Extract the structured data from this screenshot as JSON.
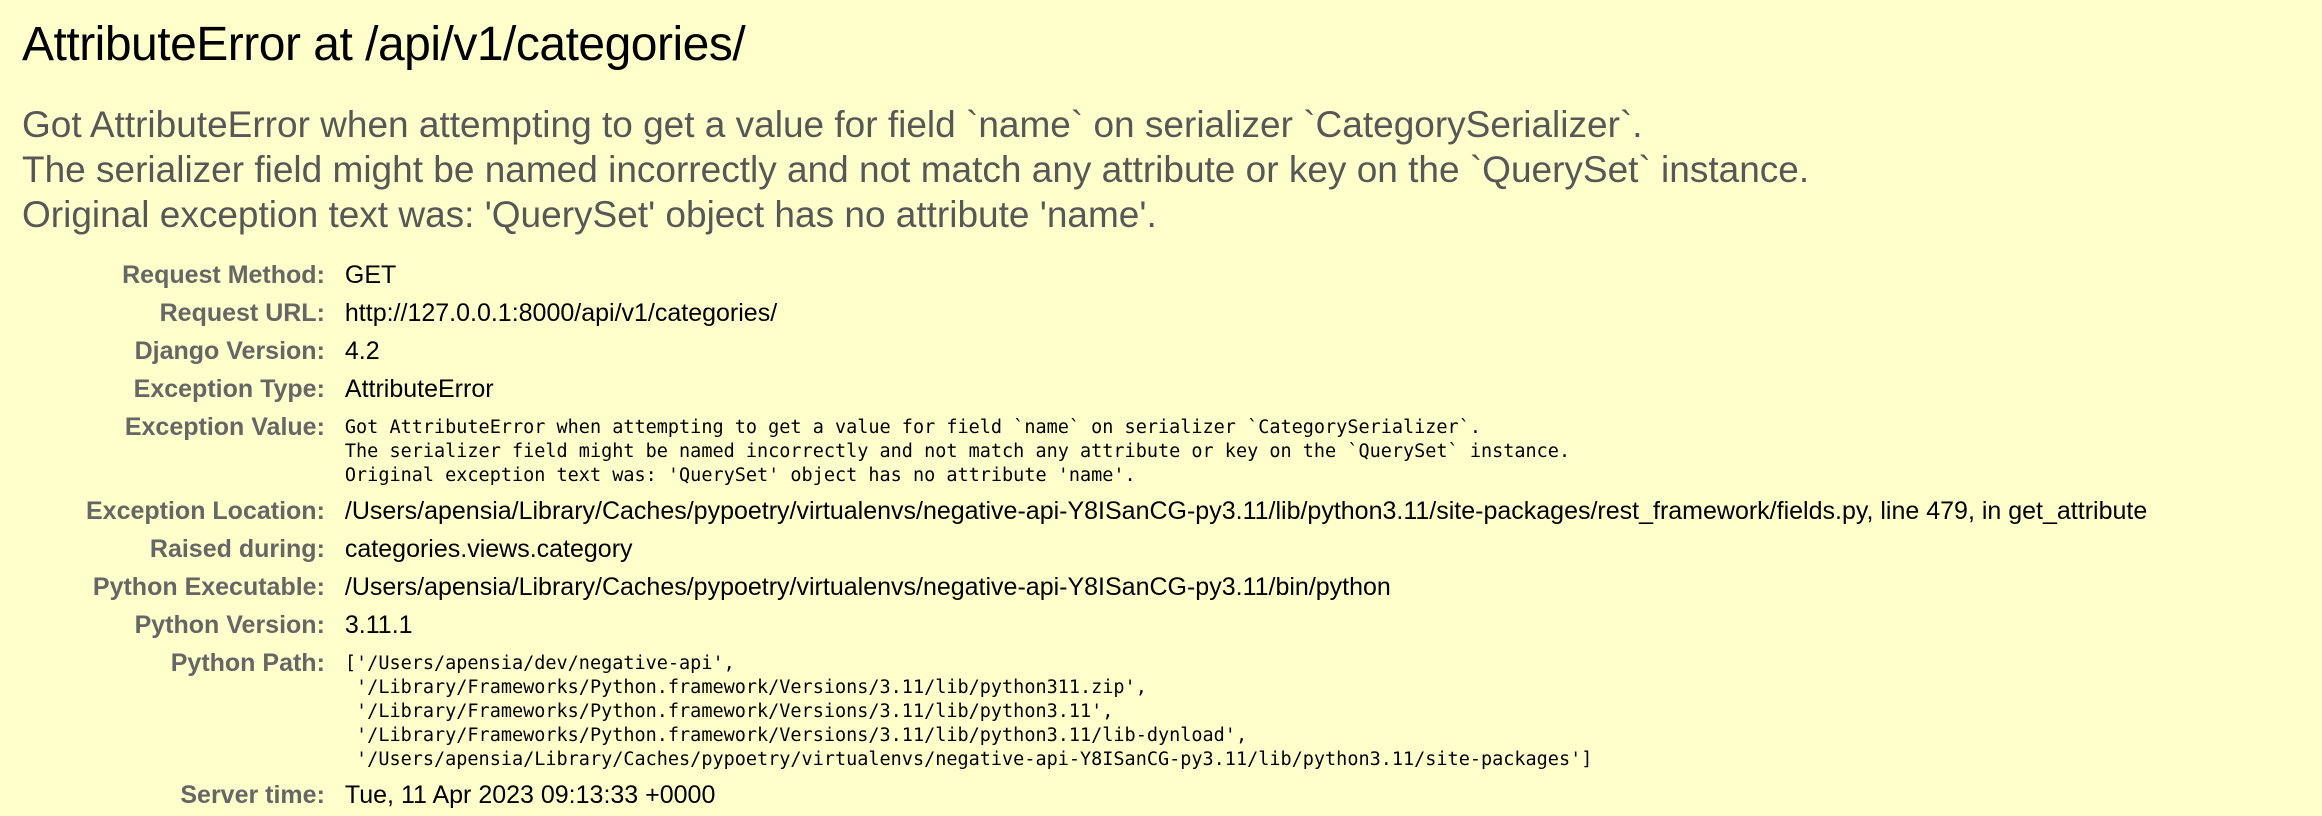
{
  "page": {
    "title": "AttributeError at /api/v1/categories/",
    "exception_value": "Got AttributeError when attempting to get a value for field `name` on serializer `CategorySerializer`.\nThe serializer field might be named incorrectly and not match any attribute or key on the `QuerySet` instance.\nOriginal exception text was: 'QuerySet' object has no attribute 'name'."
  },
  "meta": {
    "request_method": {
      "label": "Request Method:",
      "value": "GET"
    },
    "request_url": {
      "label": "Request URL:",
      "value": "http://127.0.0.1:8000/api/v1/categories/"
    },
    "django_version": {
      "label": "Django Version:",
      "value": "4.2"
    },
    "exception_type": {
      "label": "Exception Type:",
      "value": "AttributeError"
    },
    "exception_value": {
      "label": "Exception Value:",
      "value": "Got AttributeError when attempting to get a value for field `name` on serializer `CategorySerializer`.\nThe serializer field might be named incorrectly and not match any attribute or key on the `QuerySet` instance.\nOriginal exception text was: 'QuerySet' object has no attribute 'name'."
    },
    "exception_location": {
      "label": "Exception Location:",
      "value": "/Users/apensia/Library/Caches/pypoetry/virtualenvs/negative-api-Y8ISanCG-py3.11/lib/python3.11/site-packages/rest_framework/fields.py, line 479, in get_attribute"
    },
    "raised_during": {
      "label": "Raised during:",
      "value": "categories.views.category"
    },
    "python_executable": {
      "label": "Python Executable:",
      "value": "/Users/apensia/Library/Caches/pypoetry/virtualenvs/negative-api-Y8ISanCG-py3.11/bin/python"
    },
    "python_version": {
      "label": "Python Version:",
      "value": "3.11.1"
    },
    "python_path": {
      "label": "Python Path:",
      "value": "['/Users/apensia/dev/negative-api',\n '/Library/Frameworks/Python.framework/Versions/3.11/lib/python311.zip',\n '/Library/Frameworks/Python.framework/Versions/3.11/lib/python3.11',\n '/Library/Frameworks/Python.framework/Versions/3.11/lib/python3.11/lib-dynload',\n '/Users/apensia/Library/Caches/pypoetry/virtualenvs/negative-api-Y8ISanCG-py3.11/lib/python3.11/site-packages']"
    },
    "server_time": {
      "label": "Server time:",
      "value": "Tue, 11 Apr 2023 09:13:33 +0000"
    }
  },
  "colors": {
    "background": "#ffffcc",
    "title_text": "#000000",
    "summary_text": "#575757",
    "label_text": "#666666"
  }
}
